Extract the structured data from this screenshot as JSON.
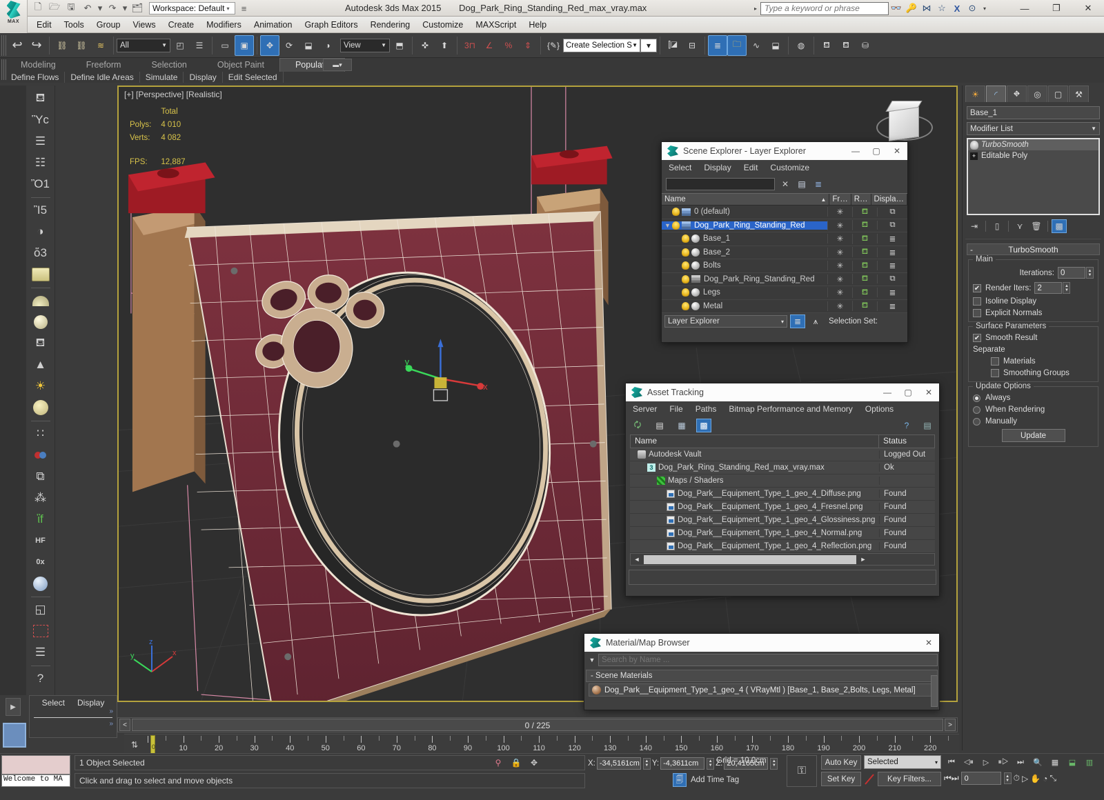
{
  "titlebar": {
    "app_title": "Autodesk 3ds Max  2015",
    "file_name": "Dog_Park_Ring_Standing_Red_max_vray.max",
    "workspace": "Workspace: Default",
    "search_placeholder": "Type a keyword or phrase",
    "logo_text": "MAX",
    "quick_access": [
      {
        "name": "new-file-icon",
        "glyph": "□"
      },
      {
        "name": "open-file-icon",
        "glyph": "▱"
      },
      {
        "name": "save-file-icon",
        "glyph": "▣"
      },
      {
        "name": "undo-icon",
        "glyph": "↶"
      },
      {
        "name": "redo-icon",
        "glyph": "↷"
      },
      {
        "name": "set-project-folder-icon",
        "glyph": "❐"
      }
    ],
    "title_icons": [
      {
        "name": "search-binoculars-icon",
        "glyph": "∞"
      },
      {
        "name": "key-icon",
        "glyph": "⚷"
      },
      {
        "name": "subscription-icon",
        "glyph": "⋈"
      },
      {
        "name": "favorites-star-icon",
        "glyph": "☆"
      },
      {
        "name": "exchange-icon",
        "glyph": "X"
      },
      {
        "name": "help-icon",
        "glyph": "?"
      }
    ],
    "window_buttons": [
      {
        "name": "minimize-button",
        "glyph": "—"
      },
      {
        "name": "restore-button",
        "glyph": "❐"
      },
      {
        "name": "close-button",
        "glyph": "✕"
      }
    ]
  },
  "menubar": {
    "items": [
      "Edit",
      "Tools",
      "Group",
      "Views",
      "Create",
      "Modifiers",
      "Animation",
      "Graph Editors",
      "Rendering",
      "Customize",
      "MAXScript",
      "Help"
    ]
  },
  "toolbar": {
    "selection_filter": "All",
    "reference_coord_system": "View",
    "named_selection_set": "Create Selection Se",
    "icons_left": [
      {
        "name": "undo-icon",
        "glyph": "←",
        "active": false
      },
      {
        "name": "redo-icon",
        "glyph": "→",
        "active": false
      },
      {
        "name": "select-and-link-icon",
        "glyph": "⛓",
        "active": false
      },
      {
        "name": "unlink-selection-icon",
        "glyph": "✂",
        "active": false
      },
      {
        "name": "bind-to-space-warp-icon",
        "glyph": "≋",
        "active": false
      }
    ],
    "icons_mid": [
      {
        "name": "select-object-icon",
        "glyph": "◱",
        "active": false
      },
      {
        "name": "select-by-name-icon",
        "glyph": "☰",
        "active": false
      },
      {
        "name": "rectangular-selection-region-icon",
        "glyph": "▭",
        "active": false
      },
      {
        "name": "window-crossing-icon",
        "glyph": "▣",
        "active": true
      },
      {
        "name": "select-and-move-icon",
        "glyph": "✥",
        "active": true
      },
      {
        "name": "select-and-rotate-icon",
        "glyph": "⟳",
        "active": false
      },
      {
        "name": "select-and-scale-icon",
        "glyph": "⬌",
        "active": false
      },
      {
        "name": "select-and-place-icon",
        "glyph": "◑",
        "active": false
      }
    ],
    "icons_right": [
      {
        "name": "use-pivot-point-center-icon",
        "glyph": "⧉",
        "active": false
      },
      {
        "name": "select-and-manipulate-icon",
        "glyph": "✣",
        "active": false
      },
      {
        "name": "snaps-toggle-icon",
        "glyph": "⬆",
        "active": false
      },
      {
        "name": "snaps-3-icon",
        "glyph": "3",
        "active": false
      },
      {
        "name": "angle-snap-toggle-icon",
        "glyph": "∡",
        "active": false
      },
      {
        "name": "percent-snap-toggle-icon",
        "glyph": "%",
        "active": false
      },
      {
        "name": "spinner-snap-toggle-icon",
        "glyph": "↕",
        "active": false
      },
      {
        "name": "edit-named-selection-sets-icon",
        "glyph": "{ }",
        "active": false
      }
    ],
    "icons_far_right": [
      {
        "name": "mirror-icon",
        "glyph": "❙◧",
        "active": false
      },
      {
        "name": "align-icon",
        "glyph": "≡",
        "active": false
      },
      {
        "name": "layer-explorer-icon",
        "glyph": "≣",
        "active": true
      },
      {
        "name": "scene-explorer-icon",
        "glyph": "❐",
        "active": true
      },
      {
        "name": "curve-editor-icon",
        "glyph": "∿",
        "active": false
      },
      {
        "name": "schematic-view-icon",
        "glyph": "⬓",
        "active": false
      },
      {
        "name": "material-editor-icon",
        "glyph": "◔",
        "active": false
      },
      {
        "name": "render-setup-icon",
        "glyph": "◕",
        "active": false
      },
      {
        "name": "rendered-frame-window-icon",
        "glyph": "○",
        "active": false
      },
      {
        "name": "render-production-icon",
        "glyph": "▷",
        "active": false
      }
    ]
  },
  "ribbon": {
    "tabs": [
      {
        "label": "Modeling",
        "active": false
      },
      {
        "label": "Freeform",
        "active": false
      },
      {
        "label": "Selection",
        "active": false
      },
      {
        "label": "Object Paint",
        "active": false
      },
      {
        "label": "Populate",
        "active": true
      }
    ],
    "panel_buttons": [
      "Define Flows",
      "Define Idle Areas",
      "Simulate",
      "Display",
      "Edit Selected"
    ]
  },
  "left_toolbar": {
    "icons": [
      {
        "name": "teapot-primitive-icon",
        "glyph": "⛾"
      },
      {
        "name": "render-preview-icon",
        "glyph": "Ὓc"
      },
      {
        "name": "list-panel-icon",
        "glyph": "☰"
      },
      {
        "name": "table-panel-icon",
        "glyph": "☷"
      },
      {
        "name": "light-lister-icon",
        "glyph": "Ὂ1"
      },
      {
        "name": "camera-icon",
        "glyph": "Ἲ5"
      },
      {
        "name": "camera-shading-icon",
        "glyph": "◑"
      },
      {
        "name": "stereo-camera-icon",
        "glyph": "ὅ3"
      },
      {
        "name": "plane-primitive-icon",
        "glyph": "▭"
      },
      {
        "name": "dome-primitive-icon",
        "glyph": "◖"
      },
      {
        "name": "sphere-primitive-icon",
        "glyph": "●"
      },
      {
        "name": "wire-teapot-icon",
        "glyph": "⛾"
      },
      {
        "name": "cone-primitive-icon",
        "glyph": "▲"
      },
      {
        "name": "sun-light-icon",
        "glyph": "☀"
      },
      {
        "name": "sky-light-icon",
        "glyph": "●"
      },
      {
        "name": "array-icon",
        "glyph": "∷"
      },
      {
        "name": "atom-icon",
        "glyph": "⚬"
      },
      {
        "name": "normals-icon",
        "glyph": "⧉"
      },
      {
        "name": "noise-icon",
        "glyph": "⁂"
      },
      {
        "name": "grass-icon",
        "glyph": "ἳf"
      },
      {
        "name": "hair-fur-icon",
        "glyph": "HF"
      },
      {
        "name": "occlusion-icon",
        "glyph": "0x"
      },
      {
        "name": "material-sphere-icon",
        "glyph": "●"
      },
      {
        "name": "assign-material-icon",
        "glyph": "◱"
      },
      {
        "name": "select-by-material-icon",
        "glyph": "▣"
      },
      {
        "name": "script-icon",
        "glyph": "☰"
      },
      {
        "name": "help-icon",
        "glyph": "?"
      }
    ]
  },
  "viewport": {
    "label": "[+] [Perspective] [Realistic]",
    "stats_header": "Total",
    "stats": [
      {
        "label": "Polys:",
        "value": "4 010"
      },
      {
        "label": "Verts:",
        "value": "4 082"
      }
    ],
    "fps_label": "FPS:",
    "fps_value": "12,887",
    "axis_labels": {
      "x": "X",
      "y": "Y",
      "z": "Z"
    },
    "model_colors": {
      "red_panel": "#7a2f3d",
      "wood": "#b08968",
      "bolt_red": "#a3202b",
      "wireframe": "#f2e8e2",
      "edge_cream": "#d7c2a8"
    }
  },
  "scene_explorer": {
    "title": "Scene Explorer - Layer Explorer",
    "menu": [
      "Select",
      "Display",
      "Edit",
      "Customize"
    ],
    "search_value": "",
    "toolbar_icons": [
      {
        "name": "clear-search-icon",
        "glyph": "✕"
      },
      {
        "name": "new-layer-icon",
        "glyph": "▤"
      },
      {
        "name": "delete-layer-icon",
        "glyph": "≣"
      }
    ],
    "columns": [
      "Name",
      "Fr…",
      "R…",
      "Displa…"
    ],
    "rows": [
      {
        "name": "0 (default)",
        "indent": 0,
        "type": "layer",
        "selected": false,
        "expander": "",
        "freeze": "✳",
        "render": "⛾",
        "display": "⧉"
      },
      {
        "name": "Dog_Park_Ring_Standing_Red",
        "indent": 0,
        "type": "layer",
        "selected": true,
        "expander": "▼",
        "freeze": "✳",
        "render": "⛾",
        "display": "⧉"
      },
      {
        "name": "Base_1",
        "indent": 1,
        "type": "object",
        "selected": false,
        "expander": "",
        "freeze": "✳",
        "render": "⛾",
        "display": "≣"
      },
      {
        "name": "Base_2",
        "indent": 1,
        "type": "object",
        "selected": false,
        "expander": "",
        "freeze": "✳",
        "render": "⛾",
        "display": "≣"
      },
      {
        "name": "Bolts",
        "indent": 1,
        "type": "object",
        "selected": false,
        "expander": "",
        "freeze": "✳",
        "render": "⛾",
        "display": "≣"
      },
      {
        "name": "Dog_Park_Ring_Standing_Red",
        "indent": 1,
        "type": "group",
        "selected": false,
        "expander": "",
        "freeze": "✳",
        "render": "⛾",
        "display": "⧉"
      },
      {
        "name": "Legs",
        "indent": 1,
        "type": "object",
        "selected": false,
        "expander": "",
        "freeze": "✳",
        "render": "⛾",
        "display": "≣"
      },
      {
        "name": "Metal",
        "indent": 1,
        "type": "object",
        "selected": false,
        "expander": "",
        "freeze": "✳",
        "render": "⛾",
        "display": "≣"
      }
    ],
    "footer_combo": "Layer Explorer",
    "selection_set_label": "Selection Set:"
  },
  "asset_tracking": {
    "title": "Asset Tracking",
    "menu": [
      "Server",
      "File",
      "Paths",
      "Bitmap Performance and Memory",
      "Options"
    ],
    "toolbar_icons": [
      {
        "name": "refresh-icon",
        "glyph": "↻",
        "active": false
      },
      {
        "name": "list-view-icon",
        "glyph": "☰",
        "active": false
      },
      {
        "name": "details-view-icon",
        "glyph": "⌸",
        "active": false
      },
      {
        "name": "grid-view-icon",
        "glyph": "▦",
        "active": true
      },
      {
        "name": "help-icon",
        "glyph": "?",
        "active": false
      }
    ],
    "columns": [
      "Name",
      "Status"
    ],
    "rows": [
      {
        "name": "Autodesk Vault",
        "status": "Logged Out",
        "indent": 0,
        "icon": "vault"
      },
      {
        "name": "Dog_Park_Ring_Standing_Red_max_vray.max",
        "status": "Ok",
        "indent": 1,
        "icon": "max"
      },
      {
        "name": "Maps / Shaders",
        "status": "",
        "indent": 2,
        "icon": "maps"
      },
      {
        "name": "Dog_Park__Equipment_Type_1_geo_4_Diffuse.png",
        "status": "Found",
        "indent": 3,
        "icon": "png"
      },
      {
        "name": "Dog_Park__Equipment_Type_1_geo_4_Fresnel.png",
        "status": "Found",
        "indent": 3,
        "icon": "png"
      },
      {
        "name": "Dog_Park__Equipment_Type_1_geo_4_Glossiness.png",
        "status": "Found",
        "indent": 3,
        "icon": "png"
      },
      {
        "name": "Dog_Park__Equipment_Type_1_geo_4_Normal.png",
        "status": "Found",
        "indent": 3,
        "icon": "png"
      },
      {
        "name": "Dog_Park__Equipment_Type_1_geo_4_Reflection.png",
        "status": "Found",
        "indent": 3,
        "icon": "png"
      }
    ]
  },
  "material_browser": {
    "title": "Material/Map Browser",
    "search_placeholder": "Search by Name ...",
    "group_label": "- Scene Materials",
    "material_entry": "Dog_Park__Equipment_Type_1_geo_4 ( VRayMtl ) [Base_1, Base_2,Bolts, Legs, Metal]"
  },
  "command_panel": {
    "tabs": [
      {
        "name": "create-tab",
        "glyph": "☀",
        "active": false
      },
      {
        "name": "modify-tab",
        "glyph": "◜",
        "active": true
      },
      {
        "name": "hierarchy-tab",
        "glyph": "⛖",
        "active": false
      },
      {
        "name": "motion-tab",
        "glyph": "◎",
        "active": false
      },
      {
        "name": "display-tab",
        "glyph": "▢",
        "active": false
      },
      {
        "name": "utilities-tab",
        "glyph": "⚒",
        "active": false
      }
    ],
    "object_name": "Base_1",
    "modifier_list_label": "Modifier List",
    "modifier_stack": [
      {
        "label": "TurboSmooth",
        "italic": true,
        "selected": true
      },
      {
        "label": "Editable Poly",
        "italic": false,
        "selected": false
      }
    ],
    "stack_tools": [
      {
        "name": "pin-stack-icon",
        "glyph": "⇥"
      },
      {
        "name": "show-end-result-icon",
        "glyph": "▀"
      },
      {
        "name": "make-unique-icon",
        "glyph": "⬇"
      },
      {
        "name": "remove-modifier-icon",
        "glyph": "Ὕ1"
      },
      {
        "name": "configure-modifier-sets-icon",
        "glyph": "☷"
      }
    ],
    "rollout_title": "TurboSmooth",
    "rollout_collapse": "-",
    "main_group_label": "Main",
    "iterations_label": "Iterations:",
    "iterations_value": "0",
    "render_iters_label": "Render Iters:",
    "render_iters_value": "2",
    "render_iters_checked": true,
    "isoline_display_label": "Isoline Display",
    "isoline_display_checked": false,
    "explicit_normals_label": "Explicit Normals",
    "explicit_normals_checked": false,
    "surface_params_label": "Surface Parameters",
    "smooth_result_label": "Smooth Result",
    "smooth_result_checked": true,
    "separate_label": "Separate",
    "materials_label": "Materials",
    "materials_checked": false,
    "smoothing_groups_label": "Smoothing Groups",
    "smoothing_groups_checked": false,
    "update_options_label": "Update Options",
    "update_options": [
      {
        "label": "Always",
        "selected": true
      },
      {
        "label": "When Rendering",
        "selected": false
      },
      {
        "label": "Manually",
        "selected": false
      }
    ],
    "update_button": "Update"
  },
  "select_display_panel": {
    "tabs": [
      "Select",
      "Display"
    ],
    "chevron": "»"
  },
  "timeline": {
    "current_frame_label": "0 / 225",
    "prev_arrow": "<",
    "next_arrow": ">",
    "ticks": [
      0,
      10,
      20,
      30,
      40,
      50,
      60,
      70,
      80,
      90,
      100,
      110,
      120,
      130,
      140,
      150,
      160,
      170,
      180,
      190,
      200,
      210,
      220
    ],
    "range_end": 225,
    "playhead_frame": 0
  },
  "statusbar": {
    "listener_text": "Welcome to MA",
    "selection_status": "1 Object Selected",
    "prompt": "Click and drag to select and move objects",
    "coords": [
      {
        "axis": "X:",
        "value": "-34,5161cm"
      },
      {
        "axis": "Y:",
        "value": "-4,3611cm"
      },
      {
        "axis": "Z:",
        "value": "20,4165cm"
      }
    ],
    "grid_label": "Grid = 10,0cm",
    "add_time_tag": "Add Time Tag",
    "auto_key": "Auto Key",
    "set_key": "Set Key",
    "key_mode_filter": "Selected",
    "key_filters": "Key Filters...",
    "frame_field": "0",
    "status_icons": [
      {
        "name": "pin-isolate-icon",
        "glyph": "⚑"
      },
      {
        "name": "lock-selection-icon",
        "glyph": "ὑ2"
      },
      {
        "name": "transform-type-in-icon",
        "glyph": "✣"
      }
    ],
    "nav_icons_row1": [
      {
        "name": "go-to-start-icon",
        "glyph": "⏮"
      },
      {
        "name": "previous-frame-icon",
        "glyph": "◁‖"
      },
      {
        "name": "play-animation-icon",
        "glyph": "▷"
      },
      {
        "name": "next-frame-icon",
        "glyph": "‖▷"
      },
      {
        "name": "go-to-end-icon",
        "glyph": "⏭"
      },
      {
        "name": "zoom-icon",
        "glyph": "⌕"
      },
      {
        "name": "zoom-all-icon",
        "glyph": "▦"
      },
      {
        "name": "zoom-extents-icon",
        "glyph": "⧉"
      },
      {
        "name": "zoom-extents-all-icon",
        "glyph": "⬚"
      }
    ],
    "nav_icons_row2": [
      {
        "name": "key-mode-toggle-icon",
        "glyph": "⏭"
      },
      {
        "name": "time-configuration-icon",
        "glyph": "⏱"
      },
      {
        "name": "field-of-view-icon",
        "glyph": "▷"
      },
      {
        "name": "pan-view-icon",
        "glyph": "✋"
      },
      {
        "name": "orbit-icon",
        "glyph": "◔"
      },
      {
        "name": "maximize-viewport-toggle-icon",
        "glyph": "⤡"
      }
    ]
  }
}
